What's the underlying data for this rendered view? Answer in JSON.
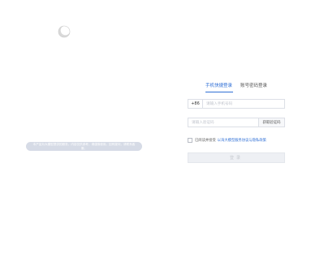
{
  "brand": {
    "logo_icon": "crescent-logo-icon"
  },
  "notice": {
    "text": "本产品为大模型提供的服务，内容仅供参考，请谨慎使用。如有疑问，请联系客服。"
  },
  "login": {
    "tabs": [
      {
        "label": "手机快捷登录",
        "active": true
      },
      {
        "label": "账号密码登录",
        "active": false
      }
    ],
    "phone": {
      "prefix": "+86",
      "placeholder": "请输入手机号码",
      "value": ""
    },
    "code": {
      "placeholder": "请输入验证码",
      "value": "",
      "get_code_label": "获取验证码"
    },
    "agreement": {
      "text": "已阅读并接受",
      "link_text": "以海大模型服务协议与隐私政策"
    },
    "submit_label": "登录"
  },
  "colors": {
    "accent": "#2f6fd6",
    "notice_bg": "#d6dbe6",
    "button_disabled_bg": "#eef0f4"
  }
}
